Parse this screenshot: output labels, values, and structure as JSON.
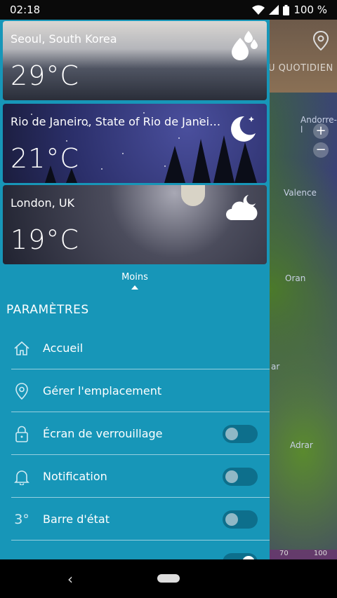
{
  "status": {
    "time": "02:18",
    "battery": "100 %"
  },
  "map": {
    "tab_text": "U QUOTIDIEN",
    "labels": [
      "Andorre-l",
      "Valence",
      "Oran",
      "ar",
      "Adrar"
    ],
    "zoom_in": "+",
    "zoom_out": "−",
    "scale": [
      "70",
      "100"
    ]
  },
  "cities": [
    {
      "name": "Seoul, South Korea",
      "temp": "29°C",
      "icon": "rain-drops-icon"
    },
    {
      "name": "Rio de Janeiro, State of Rio de Janeiro, ...",
      "temp": "21°C",
      "icon": "moon-stars-icon"
    },
    {
      "name": "London, UK",
      "temp": "19°C",
      "icon": "cloud-moon-icon"
    }
  ],
  "less_label": "Moins",
  "section_title": "PARAMÈTRES",
  "menu": [
    {
      "label": "Accueil",
      "icon": "home-icon"
    },
    {
      "label": "Gérer l'emplacement",
      "icon": "location-pin-icon"
    },
    {
      "label": "Écran de verrouillage",
      "icon": "lock-icon",
      "toggle": false
    },
    {
      "label": "Notification",
      "icon": "bell-icon",
      "toggle": false
    },
    {
      "label": "Barre d'état",
      "icon": "temperature-3-icon",
      "icon_text": "3°",
      "toggle": false
    },
    {
      "label": "",
      "icon": "partial-icon",
      "toggle": true
    }
  ],
  "colors": {
    "drawer": "#1796b8",
    "toggle_off": "#0d6f8c"
  }
}
